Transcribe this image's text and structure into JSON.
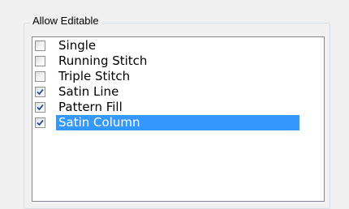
{
  "group": {
    "title": "Allow Editable"
  },
  "items": [
    {
      "label": "Single",
      "checked": false,
      "selected": false
    },
    {
      "label": "Running Stitch",
      "checked": false,
      "selected": false
    },
    {
      "label": "Triple Stitch",
      "checked": false,
      "selected": false
    },
    {
      "label": "Satin Line",
      "checked": true,
      "selected": false
    },
    {
      "label": "Pattern Fill",
      "checked": true,
      "selected": false
    },
    {
      "label": "Satin Column",
      "checked": true,
      "selected": true
    }
  ],
  "colors": {
    "selection": "#3399ff",
    "checkmark": "#2a4d9a"
  }
}
